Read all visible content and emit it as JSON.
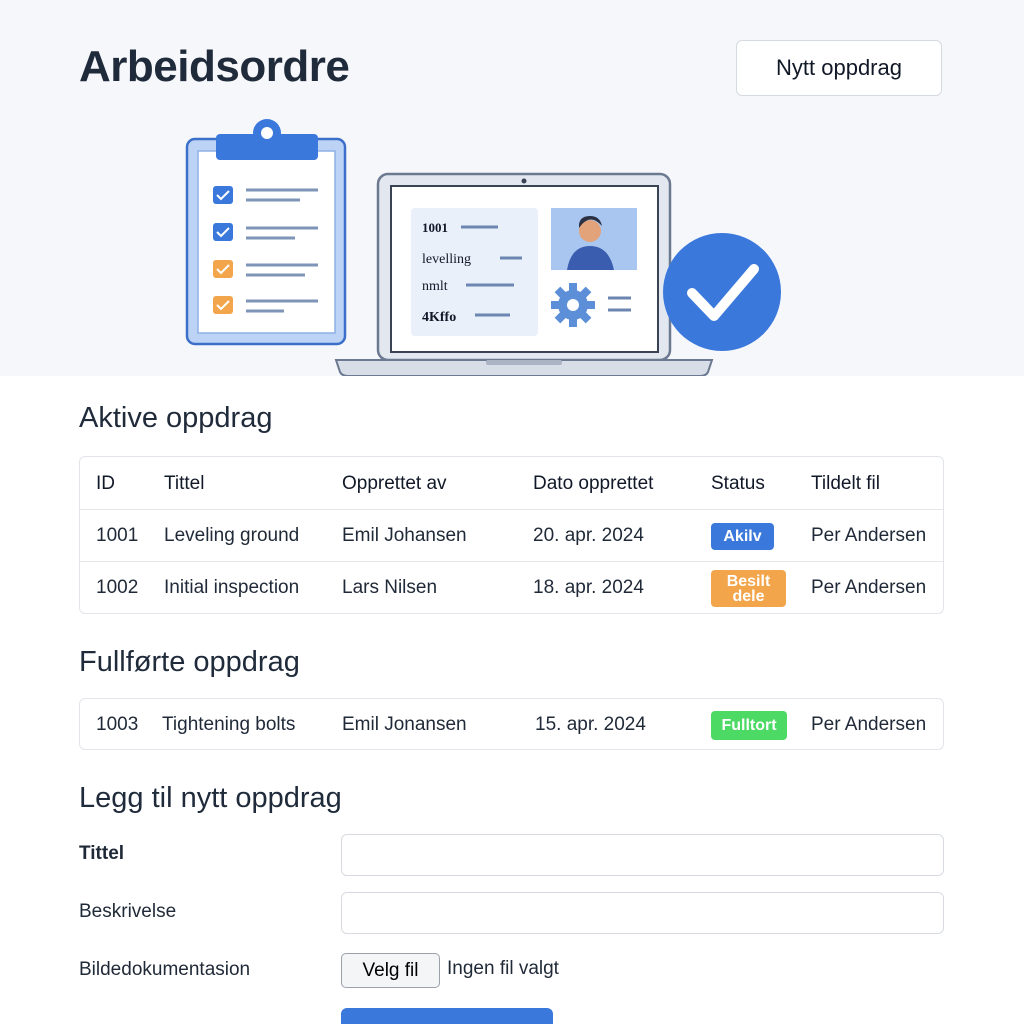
{
  "header": {
    "title": "Arbeidsordre",
    "new_button": "Nytt oppdrag"
  },
  "illustration": {
    "card_lines": [
      "1001",
      "levelling",
      "nmlt",
      "4Kffo"
    ]
  },
  "active": {
    "title": "Aktive oppdrag",
    "columns": [
      "ID",
      "Tittel",
      "Opprettet av",
      "Dato opprettet",
      "Status",
      "Tildelt fil"
    ],
    "rows": [
      {
        "id": "1001",
        "title": "Leveling ground",
        "created_by": "Emil Johansen",
        "date": "20. apr. 2024",
        "status": "Akilv",
        "status_color": "#3b78dc",
        "assigned": "Per Andersen"
      },
      {
        "id": "1002",
        "title": "Initial inspection",
        "created_by": "Lars Nilsen",
        "date": "18. apr. 2024",
        "status": "Besilt dele",
        "status_color": "#f2a54a",
        "assigned": "Per Andersen"
      }
    ]
  },
  "completed": {
    "title": "Fullførte oppdrag",
    "rows": [
      {
        "id": "1003",
        "title": "Tightening bolts",
        "created_by": "Emil Jonansen",
        "date": "15. apr. 2024",
        "status": "Fulltort",
        "status_color": "#4cd964",
        "assigned": "Per Andersen"
      }
    ]
  },
  "form": {
    "title": "Legg til nytt oppdrag",
    "title_label": "Tittel",
    "title_value": "",
    "description_label": "Beskrivelse",
    "description_value": "",
    "image_label": "Bildedokumentasion",
    "file_button": "Velg fil",
    "file_status": "Ingen fil valgt"
  },
  "colors": {
    "accent": "#3b78dc",
    "warning": "#f2a54a",
    "success": "#4cd964",
    "hero_bg": "#f6f7fb"
  }
}
